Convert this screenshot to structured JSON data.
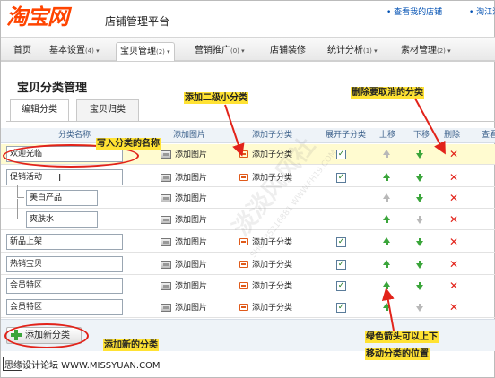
{
  "header": {
    "logo": "淘宝网",
    "platform_title": "店铺管理平台",
    "links": [
      "• 查看我的店铺",
      "• 淘江湖"
    ]
  },
  "nav": [
    {
      "label": "首页",
      "count": "",
      "active": false
    },
    {
      "label": "基本设置",
      "count": "(4)",
      "active": false
    },
    {
      "label": "宝贝管理",
      "count": "(2)",
      "active": true
    },
    {
      "label": "营销推广",
      "count": "(0)",
      "active": false
    },
    {
      "label": "店铺装修",
      "count": "",
      "active": false
    },
    {
      "label": "统计分析",
      "count": "(1)",
      "active": false
    },
    {
      "label": "素材管理",
      "count": "(2)",
      "active": false
    }
  ],
  "page_title": "宝贝分类管理",
  "tabs": [
    {
      "label": "编辑分类",
      "active": true
    },
    {
      "label": "宝贝归类",
      "active": false
    }
  ],
  "columns": {
    "name": "分类名称",
    "image": "添加图片",
    "sub": "添加子分类",
    "expand": "展开子分类",
    "up": "上移",
    "down": "下移",
    "delete": "删除",
    "view": "查看"
  },
  "rows": [
    {
      "name": "欢迎光临",
      "image": "添加图片",
      "sub": "添加子分类",
      "expand": true,
      "level": 0,
      "up_enabled": false,
      "down_enabled": true,
      "highlight": true
    },
    {
      "name": "促销活动",
      "image": "添加图片",
      "sub": "添加子分类",
      "expand": true,
      "level": 0,
      "up_enabled": true,
      "down_enabled": true,
      "highlight": false
    },
    {
      "name": "美白产品",
      "image": "添加图片",
      "sub": "",
      "expand": false,
      "level": 1,
      "up_enabled": false,
      "down_enabled": true,
      "highlight": false
    },
    {
      "name": "爽肤水",
      "image": "添加图片",
      "sub": "",
      "expand": false,
      "level": 1,
      "up_enabled": true,
      "down_enabled": false,
      "highlight": false
    },
    {
      "name": "新品上架",
      "image": "添加图片",
      "sub": "添加子分类",
      "expand": true,
      "level": 0,
      "up_enabled": true,
      "down_enabled": true,
      "highlight": false
    },
    {
      "name": "热销宝贝",
      "image": "添加图片",
      "sub": "添加子分类",
      "expand": true,
      "level": 0,
      "up_enabled": true,
      "down_enabled": true,
      "highlight": false
    },
    {
      "name": "会员特区",
      "image": "添加图片",
      "sub": "添加子分类",
      "expand": true,
      "level": 0,
      "up_enabled": true,
      "down_enabled": true,
      "highlight": false
    },
    {
      "name": "会员特区",
      "image": "添加图片",
      "sub": "添加子分类",
      "expand": true,
      "level": 0,
      "up_enabled": true,
      "down_enabled": false,
      "highlight": false
    }
  ],
  "add_button": "添加新分类",
  "annotations": {
    "add_sub": "添加二级小分类",
    "delete": "删除要取消的分类",
    "write_name": "写入分类的名称",
    "add_new": "添加新的分类",
    "arrows_line1": "绿色箭头可以上下",
    "arrows_line2": "移动分类的位置"
  },
  "watermark": "淡淡风风社",
  "watermark_small": "SHOP35216881 WWW.FH19.COM",
  "credit": "思缘设计论坛 WWW.MISSYUAN.COM"
}
